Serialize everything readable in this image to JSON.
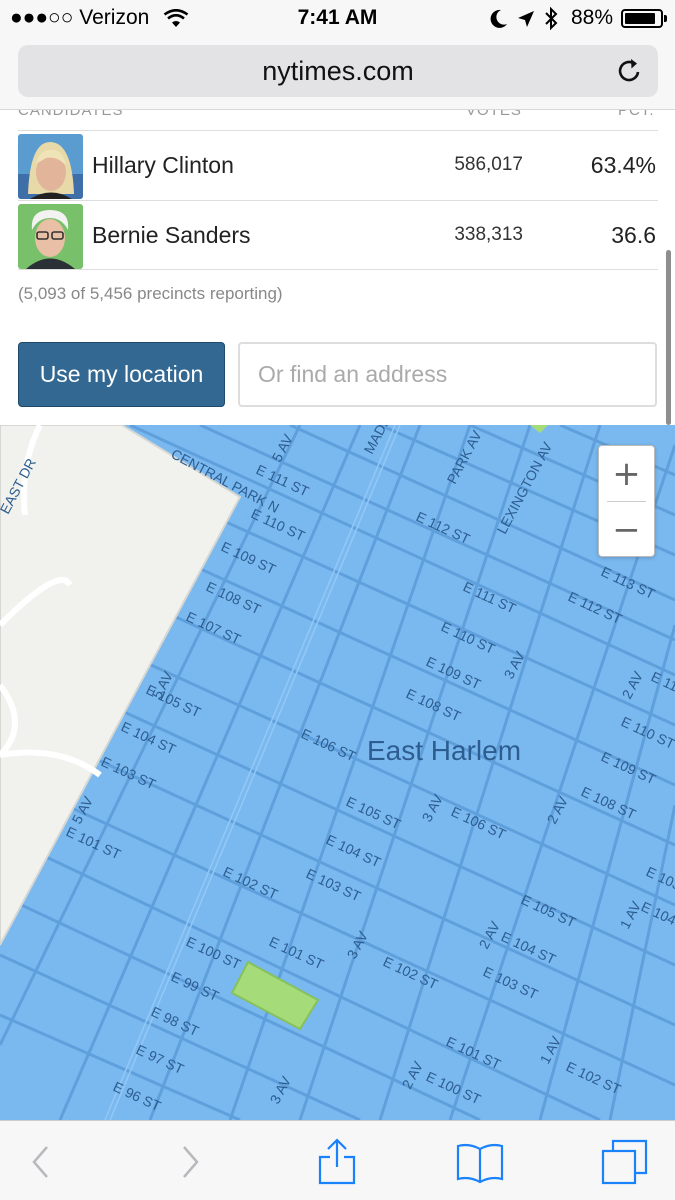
{
  "status_bar": {
    "carrier": "●●●○○ Verizon",
    "time": "7:41 AM",
    "battery_pct": "88%",
    "battery_level": 0.88
  },
  "browser": {
    "url": "nytimes.com",
    "reload_icon": "reload-icon"
  },
  "results": {
    "columns": [
      "CANDIDATES",
      "VOTES",
      "PCT."
    ],
    "candidates": [
      {
        "name": "Hillary Clinton",
        "votes": "586,017",
        "pct": "63.4%"
      },
      {
        "name": "Bernie Sanders",
        "votes": "338,313",
        "pct": "36.6"
      }
    ],
    "precincts": "(5,093 of 5,456 precincts reporting)"
  },
  "location": {
    "button_label": "Use my location",
    "address_placeholder": "Or find an address"
  },
  "map": {
    "neighborhood": "East Harlem",
    "zoom_in": "+",
    "zoom_out": "−",
    "colors": {
      "clinton_area": "#7ab9f0",
      "sanders_area": "#a5db79",
      "park": "#f1f1ee"
    },
    "street_labels": [
      "E 113 ST",
      "E 112 ST",
      "E 111 ST",
      "E 110 ST",
      "E 109 ST",
      "E 108 ST",
      "E 107 ST",
      "E 106 ST",
      "E 105 ST",
      "E 104 ST",
      "E 103 ST",
      "E 102 ST",
      "E 101 ST",
      "E 100 ST",
      "E 99 ST",
      "E 98 ST",
      "E 97 ST",
      "E 96 ST",
      "5 AV",
      "3 AV",
      "2 AV",
      "1 AV",
      "PARK AV",
      "LEXINGTON AV",
      "MADISON AV",
      "CENTRAL PARK N",
      "EAST DR"
    ]
  },
  "toolbar": {
    "icons": [
      "back-icon",
      "forward-icon",
      "share-icon",
      "bookmarks-icon",
      "tabs-icon"
    ]
  }
}
